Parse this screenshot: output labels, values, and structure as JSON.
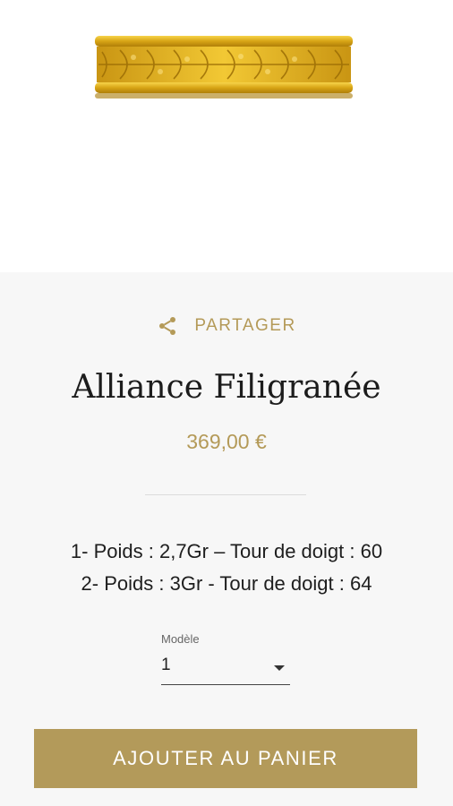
{
  "product": {
    "image_alt": "gold-filigree-ring",
    "share_label": "PARTAGER",
    "title": "Alliance Filigranée",
    "price": "369,00 €",
    "description_lines": [
      "1- Poids : 2,7Gr – Tour de doigt : 60",
      "2- Poids : 3Gr - Tour de doigt : 64"
    ]
  },
  "variant_select": {
    "label": "Modèle",
    "value": "1"
  },
  "add_to_cart_label": "AJOUTER AU PANIER",
  "colors": {
    "accent_gold": "#b39a5a",
    "background": "#f7f7f7",
    "image_background": "#ffffff"
  },
  "icons": {
    "share": "share-icon",
    "dropdown": "chevron-down-icon"
  }
}
